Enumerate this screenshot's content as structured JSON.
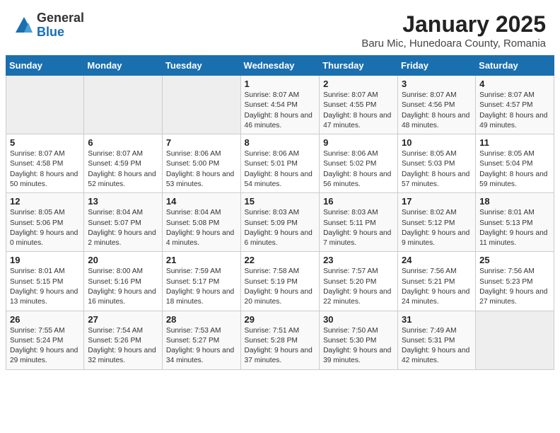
{
  "logo": {
    "general": "General",
    "blue": "Blue"
  },
  "title": "January 2025",
  "location": "Baru Mic, Hunedoara County, Romania",
  "headers": [
    "Sunday",
    "Monday",
    "Tuesday",
    "Wednesday",
    "Thursday",
    "Friday",
    "Saturday"
  ],
  "weeks": [
    [
      {
        "day": "",
        "info": ""
      },
      {
        "day": "",
        "info": ""
      },
      {
        "day": "",
        "info": ""
      },
      {
        "day": "1",
        "info": "Sunrise: 8:07 AM\nSunset: 4:54 PM\nDaylight: 8 hours and 46 minutes."
      },
      {
        "day": "2",
        "info": "Sunrise: 8:07 AM\nSunset: 4:55 PM\nDaylight: 8 hours and 47 minutes."
      },
      {
        "day": "3",
        "info": "Sunrise: 8:07 AM\nSunset: 4:56 PM\nDaylight: 8 hours and 48 minutes."
      },
      {
        "day": "4",
        "info": "Sunrise: 8:07 AM\nSunset: 4:57 PM\nDaylight: 8 hours and 49 minutes."
      }
    ],
    [
      {
        "day": "5",
        "info": "Sunrise: 8:07 AM\nSunset: 4:58 PM\nDaylight: 8 hours and 50 minutes."
      },
      {
        "day": "6",
        "info": "Sunrise: 8:07 AM\nSunset: 4:59 PM\nDaylight: 8 hours and 52 minutes."
      },
      {
        "day": "7",
        "info": "Sunrise: 8:06 AM\nSunset: 5:00 PM\nDaylight: 8 hours and 53 minutes."
      },
      {
        "day": "8",
        "info": "Sunrise: 8:06 AM\nSunset: 5:01 PM\nDaylight: 8 hours and 54 minutes."
      },
      {
        "day": "9",
        "info": "Sunrise: 8:06 AM\nSunset: 5:02 PM\nDaylight: 8 hours and 56 minutes."
      },
      {
        "day": "10",
        "info": "Sunrise: 8:05 AM\nSunset: 5:03 PM\nDaylight: 8 hours and 57 minutes."
      },
      {
        "day": "11",
        "info": "Sunrise: 8:05 AM\nSunset: 5:04 PM\nDaylight: 8 hours and 59 minutes."
      }
    ],
    [
      {
        "day": "12",
        "info": "Sunrise: 8:05 AM\nSunset: 5:06 PM\nDaylight: 9 hours and 0 minutes."
      },
      {
        "day": "13",
        "info": "Sunrise: 8:04 AM\nSunset: 5:07 PM\nDaylight: 9 hours and 2 minutes."
      },
      {
        "day": "14",
        "info": "Sunrise: 8:04 AM\nSunset: 5:08 PM\nDaylight: 9 hours and 4 minutes."
      },
      {
        "day": "15",
        "info": "Sunrise: 8:03 AM\nSunset: 5:09 PM\nDaylight: 9 hours and 6 minutes."
      },
      {
        "day": "16",
        "info": "Sunrise: 8:03 AM\nSunset: 5:11 PM\nDaylight: 9 hours and 7 minutes."
      },
      {
        "day": "17",
        "info": "Sunrise: 8:02 AM\nSunset: 5:12 PM\nDaylight: 9 hours and 9 minutes."
      },
      {
        "day": "18",
        "info": "Sunrise: 8:01 AM\nSunset: 5:13 PM\nDaylight: 9 hours and 11 minutes."
      }
    ],
    [
      {
        "day": "19",
        "info": "Sunrise: 8:01 AM\nSunset: 5:15 PM\nDaylight: 9 hours and 13 minutes."
      },
      {
        "day": "20",
        "info": "Sunrise: 8:00 AM\nSunset: 5:16 PM\nDaylight: 9 hours and 16 minutes."
      },
      {
        "day": "21",
        "info": "Sunrise: 7:59 AM\nSunset: 5:17 PM\nDaylight: 9 hours and 18 minutes."
      },
      {
        "day": "22",
        "info": "Sunrise: 7:58 AM\nSunset: 5:19 PM\nDaylight: 9 hours and 20 minutes."
      },
      {
        "day": "23",
        "info": "Sunrise: 7:57 AM\nSunset: 5:20 PM\nDaylight: 9 hours and 22 minutes."
      },
      {
        "day": "24",
        "info": "Sunrise: 7:56 AM\nSunset: 5:21 PM\nDaylight: 9 hours and 24 minutes."
      },
      {
        "day": "25",
        "info": "Sunrise: 7:56 AM\nSunset: 5:23 PM\nDaylight: 9 hours and 27 minutes."
      }
    ],
    [
      {
        "day": "26",
        "info": "Sunrise: 7:55 AM\nSunset: 5:24 PM\nDaylight: 9 hours and 29 minutes."
      },
      {
        "day": "27",
        "info": "Sunrise: 7:54 AM\nSunset: 5:26 PM\nDaylight: 9 hours and 32 minutes."
      },
      {
        "day": "28",
        "info": "Sunrise: 7:53 AM\nSunset: 5:27 PM\nDaylight: 9 hours and 34 minutes."
      },
      {
        "day": "29",
        "info": "Sunrise: 7:51 AM\nSunset: 5:28 PM\nDaylight: 9 hours and 37 minutes."
      },
      {
        "day": "30",
        "info": "Sunrise: 7:50 AM\nSunset: 5:30 PM\nDaylight: 9 hours and 39 minutes."
      },
      {
        "day": "31",
        "info": "Sunrise: 7:49 AM\nSunset: 5:31 PM\nDaylight: 9 hours and 42 minutes."
      },
      {
        "day": "",
        "info": ""
      }
    ]
  ]
}
